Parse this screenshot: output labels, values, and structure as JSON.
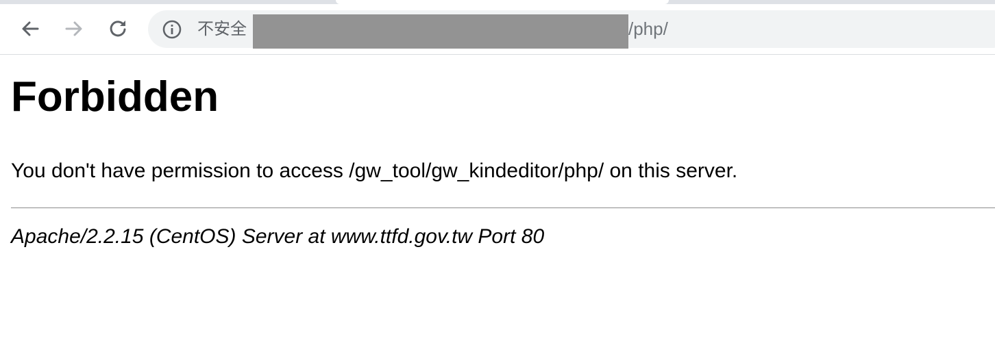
{
  "browser": {
    "address_bar": {
      "security_label": "不安全",
      "url_visible_suffix": "/php/"
    },
    "icons": {
      "back": "back-arrow-icon",
      "forward": "forward-arrow-icon",
      "reload": "reload-icon",
      "info": "info-icon"
    }
  },
  "page": {
    "title": "Forbidden",
    "message": "You don't have permission to access /gw_tool/gw_kindeditor/php/ on this server.",
    "server_signature": "Apache/2.2.15 (CentOS) Server at www.ttfd.gov.tw Port 80"
  }
}
